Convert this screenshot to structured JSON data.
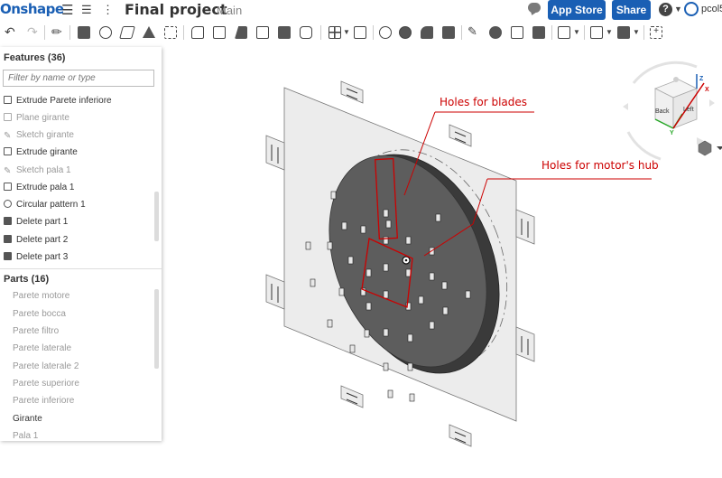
{
  "header": {
    "logo": "Onshape",
    "document_title": "Final project",
    "workspace": "Main",
    "app_store_label": "App Store",
    "share_label": "Share",
    "help_label": "?",
    "username": "pcol5"
  },
  "features": {
    "heading": "Features (36)",
    "filter_placeholder": "Filter by name or type",
    "items": [
      {
        "label": "Extrude Parete inferiore",
        "suppressed": false
      },
      {
        "label": "Plane girante",
        "suppressed": true
      },
      {
        "label": "Sketch girante",
        "suppressed": true
      },
      {
        "label": "Extrude girante",
        "suppressed": false
      },
      {
        "label": "Sketch pala 1",
        "suppressed": true
      },
      {
        "label": "Extrude pala 1",
        "suppressed": false
      },
      {
        "label": "Circular pattern 1",
        "suppressed": false
      },
      {
        "label": "Delete part 1",
        "suppressed": false
      },
      {
        "label": "Delete part 2",
        "suppressed": false
      },
      {
        "label": "Delete part 3",
        "suppressed": false
      }
    ]
  },
  "parts": {
    "heading": "Parts (16)",
    "items": [
      {
        "label": "Parete motore",
        "active": false
      },
      {
        "label": "Parete bocca",
        "active": false
      },
      {
        "label": "Parete filtro",
        "active": false
      },
      {
        "label": "Parete laterale",
        "active": false
      },
      {
        "label": "Parete laterale 2",
        "active": false
      },
      {
        "label": "Parete superiore",
        "active": false
      },
      {
        "label": "Parete inferiore",
        "active": false
      },
      {
        "label": "Girante",
        "active": true
      },
      {
        "label": "Pala 1",
        "active": false
      }
    ]
  },
  "annotations": {
    "blades": "Holes for blades",
    "hub": "Holes for motor's hub"
  },
  "view_cube": {
    "back_label": "Back",
    "left_label": "Left",
    "x_axis": "X",
    "y_axis": "Y",
    "z_axis": "Z"
  },
  "colors": {
    "brand": "#1a5fb4",
    "annotation": "#cc0000",
    "disc": "#5f5f5f",
    "plate": "#e9e9e9"
  }
}
